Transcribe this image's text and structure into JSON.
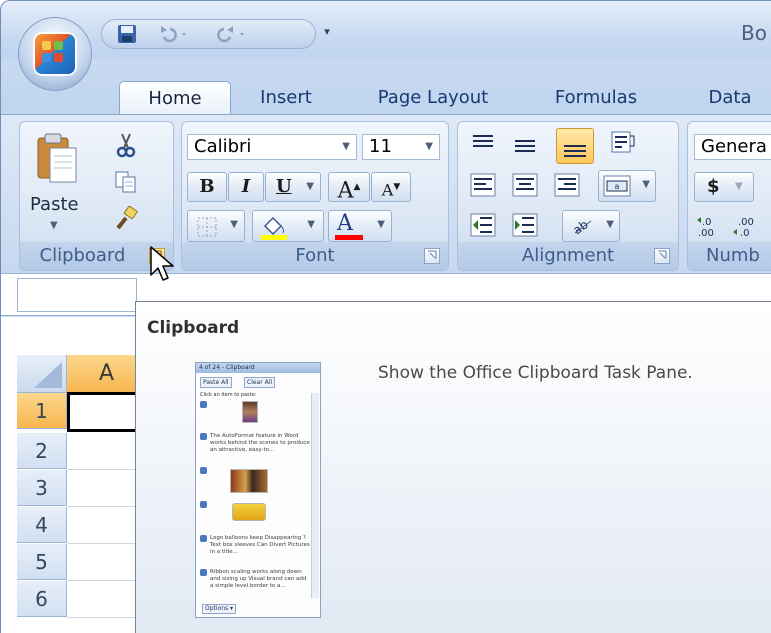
{
  "app": {
    "window_title": "Bo",
    "accent_color": "#f7b54f",
    "ribbon_text_color": "#173a73"
  },
  "quick_access": {
    "save_icon": "save-icon",
    "undo_icon": "undo-icon",
    "redo_icon": "redo-icon",
    "customize_glyph": "▾"
  },
  "tabs": [
    {
      "label": "Home",
      "active": true
    },
    {
      "label": "Insert"
    },
    {
      "label": "Page Layout"
    },
    {
      "label": "Formulas"
    },
    {
      "label": "Data"
    }
  ],
  "ribbon": {
    "clipboard": {
      "label": "Clipboard",
      "paste_label": "Paste",
      "cut_icon": "scissors-icon",
      "copy_icon": "copy-icon",
      "format_painter_icon": "format-painter-icon"
    },
    "font": {
      "label": "Font",
      "font_name": "Calibri",
      "font_size": "11",
      "bold": "B",
      "italic": "I",
      "underline": "U",
      "grow_font": "A",
      "shrink_font": "A",
      "fill_color": "#ffff00",
      "font_color": "#ff0000"
    },
    "alignment": {
      "label": "Alignment"
    },
    "number": {
      "label": "Numb",
      "format": "Genera",
      "currency": "$"
    }
  },
  "sheet": {
    "column_a": "A",
    "rows": [
      "1",
      "2",
      "3",
      "4",
      "5",
      "6"
    ]
  },
  "tooltip": {
    "title": "Clipboard",
    "description": "Show the Office Clipboard Task Pane.",
    "pane_preview": {
      "title": "4 of 24 - Clipboard",
      "paste_all": "Paste All",
      "clear_all": "Clear All",
      "hint": "Click an item to paste:",
      "item_text_1": "The AutoFormat feature in Word works behind the scenes to produce an attractive, easy-to...",
      "item_text_2": "Logo balloons keep Disappearing ? Text box sleeves Can Divert Pictures in a title...",
      "item_text_3": "Ribbon scaling works along down and sizing up Visual brand can add a simple level border to a...",
      "options": "Options ▾"
    }
  }
}
